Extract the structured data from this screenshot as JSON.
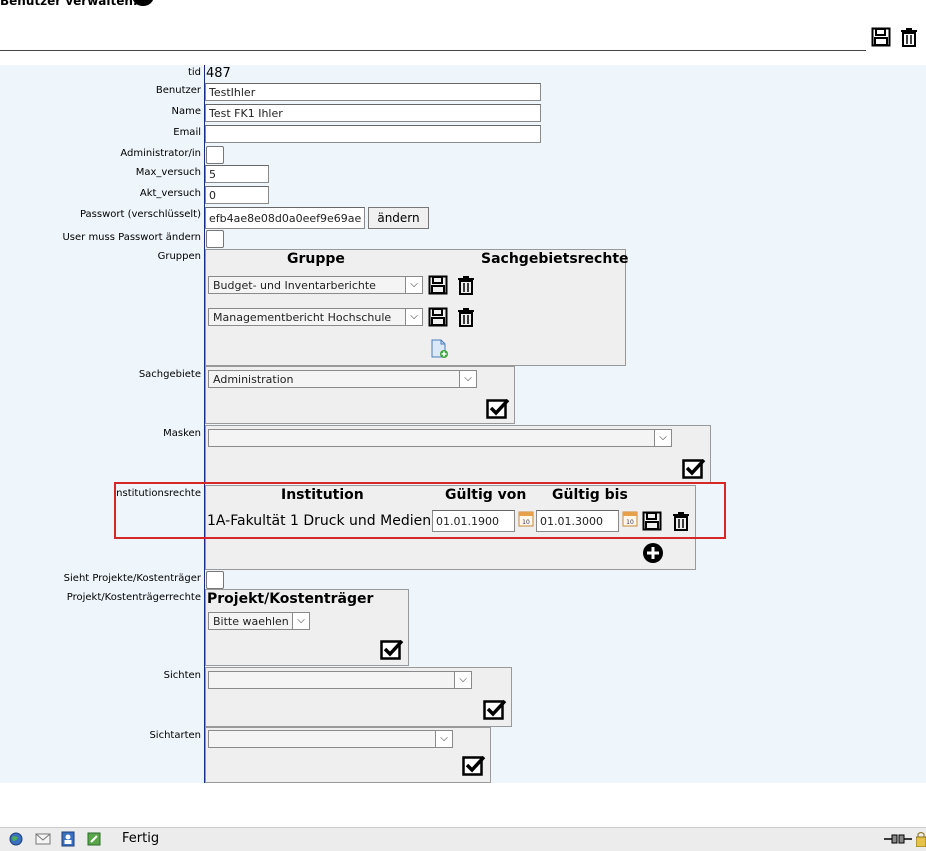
{
  "header": {
    "title": "Benutzer verwalten:"
  },
  "form": {
    "tid": {
      "label": "tid",
      "value": "487"
    },
    "benutzer": {
      "label": "Benutzer",
      "value": "TestIhler"
    },
    "name": {
      "label": "Name",
      "value": "Test FK1 Ihler"
    },
    "email": {
      "label": "Email",
      "value": ""
    },
    "admin": {
      "label": "Administrator/in"
    },
    "max_versuch": {
      "label": "Max_versuch",
      "value": "5"
    },
    "akt_versuch": {
      "label": "Akt_versuch",
      "value": "0"
    },
    "passwort": {
      "label": "Passwort (verschlüsselt)",
      "value": "efb4ae8e08d0a0eef9e69ae",
      "button": "ändern"
    },
    "pw_change": {
      "label": "User muss Passwort ändern"
    },
    "gruppen": {
      "label": "Gruppen",
      "col_gruppe": "Gruppe",
      "col_rechte": "Sachgebietsrechte",
      "rows": [
        {
          "value": "Budget- und Inventarberichte"
        },
        {
          "value": "Managementbericht Hochschule"
        }
      ]
    },
    "sachgebiete": {
      "label": "Sachgebiete",
      "value": "Administration"
    },
    "masken": {
      "label": "Masken",
      "value": ""
    },
    "institutionsrechte": {
      "label": "Institutionsrechte",
      "col_institution": "Institution",
      "col_von": "Gültig von",
      "col_bis": "Gültig bis",
      "row": {
        "institution": "1A-Fakultät 1 Druck und Medien",
        "von": "01.01.1900",
        "bis": "01.01.3000"
      }
    },
    "sieht_projekte": {
      "label": "Sieht Projekte/Kostenträger"
    },
    "projektrechte": {
      "label": "Projekt/Kostenträgerrechte",
      "col": "Projekt/Kostenträger",
      "value": "Bitte waehlen"
    },
    "sichten": {
      "label": "Sichten",
      "value": ""
    },
    "sichtarten": {
      "label": "Sichtarten",
      "value": ""
    }
  },
  "statusbar": {
    "text": "Fertig"
  },
  "colors": {
    "panel": "#eef5fb",
    "highlight": "#d62828",
    "divider": "#1a2a8c"
  }
}
